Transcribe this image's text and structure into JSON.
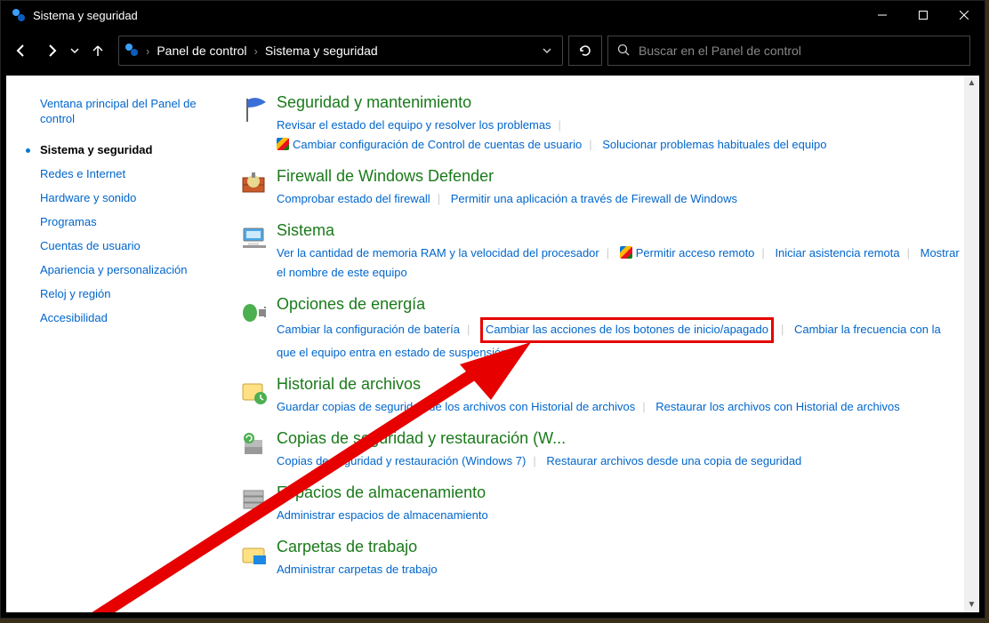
{
  "window": {
    "title": "Sistema y seguridad"
  },
  "breadcrumb": {
    "root": "Panel de control",
    "current": "Sistema y seguridad"
  },
  "search": {
    "placeholder": "Buscar en el Panel de control"
  },
  "sidebar": {
    "home": "Ventana principal del Panel de control",
    "items": [
      {
        "label": "Sistema y seguridad",
        "active": true
      },
      {
        "label": "Redes e Internet"
      },
      {
        "label": "Hardware y sonido"
      },
      {
        "label": "Programas"
      },
      {
        "label": "Cuentas de usuario"
      },
      {
        "label": "Apariencia y personalización"
      },
      {
        "label": "Reloj y región"
      },
      {
        "label": "Accesibilidad"
      }
    ]
  },
  "sections": {
    "security": {
      "title": "Seguridad y mantenimiento",
      "links": {
        "review": "Revisar el estado del equipo y resolver los problemas",
        "uac": "Cambiar configuración de Control de cuentas de usuario",
        "troubleshoot": "Solucionar problemas habituales del equipo"
      }
    },
    "firewall": {
      "title": "Firewall de Windows Defender",
      "links": {
        "check": "Comprobar estado del firewall",
        "allow": "Permitir una aplicación a través de Firewall de Windows"
      }
    },
    "system": {
      "title": "Sistema",
      "links": {
        "ram": "Ver la cantidad de memoria RAM y la velocidad del procesador",
        "remote": "Permitir acceso remoto",
        "assist": "Iniciar asistencia remota",
        "name": "Mostrar el nombre de este equipo"
      }
    },
    "power": {
      "title": "Opciones de energía",
      "links": {
        "battery": "Cambiar la configuración de batería",
        "buttons": "Cambiar las acciones de los botones de inicio/apagado",
        "sleep": "Cambiar la frecuencia con la que el equipo entra en estado de suspensión"
      }
    },
    "filehistory": {
      "title": "Historial de archivos",
      "links": {
        "save": "Guardar copias de seguridad de los archivos con Historial de archivos",
        "restore": "Restaurar los archivos con Historial de archivos"
      }
    },
    "backup": {
      "title": "Copias de seguridad y restauración (W...",
      "links": {
        "br7": "Copias de seguridad y restauración (Windows 7)",
        "restore": "Restaurar archivos desde una copia de seguridad"
      }
    },
    "storage": {
      "title": "Espacios de almacenamiento",
      "links": {
        "manage": "Administrar espacios de almacenamiento"
      }
    },
    "workfolders": {
      "title": "Carpetas de trabajo",
      "links": {
        "manage": "Administrar carpetas de trabajo"
      }
    }
  }
}
